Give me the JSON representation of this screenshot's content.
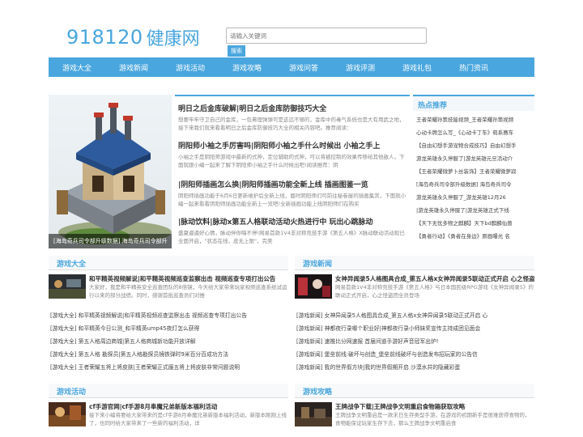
{
  "header": {
    "logo_digits": "918120",
    "logo_cn": "健康网",
    "search_placeholder": "请输入关键词",
    "search_button": "搜索"
  },
  "nav": [
    "游戏大全",
    "游戏新闻",
    "游戏活动",
    "游戏攻略",
    "游戏问答",
    "游戏评测",
    "游戏礼包",
    "热门资讯"
  ],
  "hero": {
    "caption": "[海岛奇兵司令部升级数据] 海岛奇兵司令部升"
  },
  "headlines": [
    {
      "title": "明日之后金库破解|明日之后金库防御技巧大全",
      "desc": "想要牢牢守卫自己的金库，一包弗理弹弹可是这远不够的，金库中的毒气系统也是大有用武之地，接下来我们就来看看明日之后金库防御技巧大全的相关内容吧。推荐阅读："
    },
    {
      "title": "阴阳师小袖之手厉害吗|阴阳师小袖之手什么时候出 小袖之手上",
      "desc": "小袖之手是阴阳师游戏中最新的式神，定位辅助的式神，可以将被控制的效果传移给其他敌人，下面就跟小编一起来了解下阴阳师小袖之手什么时候出吧!阅读推荐：阴"
    },
    {
      "title": "|阴阳师插画怎么换|阴阳师插画功能全新上线 插画图鉴一览",
      "desc": "阴阳师插画功能于6月6日更新维护后全新上线，届时阴阳师们可前往秘卷屋的插画集赏，下面就小编一起来看看阴阳师插画功能全新上一览吧!全新插画功能上线阴阳师们在购买"
    },
    {
      "title": "|脉动饮料|脉动x第五人格联动活动火热进行中 玩出心跳脉动",
      "desc": "盛夏逼逼好心情，脉动伴你嗨不停!网易首款1V4非对称竞技手游《第五人格》X脉动联动活动现已全面开启，\"状态在线，皮无上限\"，完美"
    }
  ],
  "hot": {
    "title": "热点推荐",
    "items": [
      "王者荣耀孙策技能视频_王者荣耀孙策视频",
      "心动卡牌怎么写_《心动卡丁车》萌系赛车",
      "【自由幻想手游宠物合成技巧】自由幻想手",
      "游龙英雄永久停服了|游龙英雄元旦活动介",
      "【王者荣耀微萝卜丝装饰】王者荣耀微萝寂",
      "[海岛奇兵司令部升级数据] 海岛奇兵司令",
      "游龙英雄永久停服了_游龙英雄12月26",
      "|游龙英雄永久停服了|游龙英雄正式下线",
      "【天下无忧多物之麒麟】天下bd麒麟仙兽",
      "【勇者行动】《勇者在身边》原画曝光 名"
    ]
  },
  "sections": [
    {
      "title": "游戏大全",
      "feature_title": "和平精英视频解说|和平精英视频巡查监察出击 视频巡查专项打出公告",
      "feature_desc": "大家好，我是和平精英安全巡查团队的8倍镜，今天给大家带来玩家视频巡查系统试运行以来的部分战绩。同时，感谢首批巡查员们对推",
      "items": [
        "[游戏大全] 和平精英视频解说|和平精英视频巡查监察出击 视频巡查专项打出公告",
        "[游戏大全] 和平精英今日公测_和平精英ump45夜灯怎么获得",
        "[游戏大全] 第五人格周边商城|第五人格商城新功能开放详解",
        "[游戏大全] 第五人格 勘探员|第五人格勘探员镜铁弹时9米百分百成功方法",
        "[游戏大全] 王者荣耀五将上将皮肤|王者荣耀正式服五将上将皮肤非常问题说明"
      ]
    },
    {
      "title": "游戏新闻",
      "feature_title": "女神异闻录5人格图具合成_第五人格x女神异闻录5联动正式开启 心之怪盗团登场",
      "feature_desc": "网易首款1V4非对称竞技手游《第五人格》与日本国民级RPG游戏《女神异闻录5》的联动正式开启，心之怪盗团全员登场",
      "items": [
        "[游戏新闻] 女神异闻录5人格图具合成_第五人格x女神异闻录5联动正式开启 心",
        "[游戏新闻] 神都夜行录哪个职业好|神都夜行录小师妹奖宣传主持成团见面会",
        "[游戏新闻] 速推比分网速报 首届间道手游好声音冠军出炉!",
        "[游戏新闻] 堡垒前线:破坏与创造_堡垒前线破坏与创造发布招玩家的公告信",
        "[游戏新闻] 我的世界假方块|我的世界假期开启 沙漠水井的隐藏彩蛋"
      ]
    },
    {
      "title": "游戏活动",
      "feature_title": "cf手游官网|cf手游8月奉魔兄弟新版本福利活动",
      "feature_desc": "接下来小编将要给大家带来的是cf手游8月奉魔兄弟新版本福利活动，新版本刚刚上线了，也同时给大家带来了一些新的福利活动，详"
    },
    {
      "title": "游戏攻略",
      "feature_title": "王牌战争下载|王牌战争文明重启食物箱获取攻略",
      "feature_desc": "王牌战争文明重启是一款末日生存类型手游，在游戏的初期新手是很难获得食物的，食物能保证玩家生存下去，那么王牌战争文明重启食"
    }
  ]
}
